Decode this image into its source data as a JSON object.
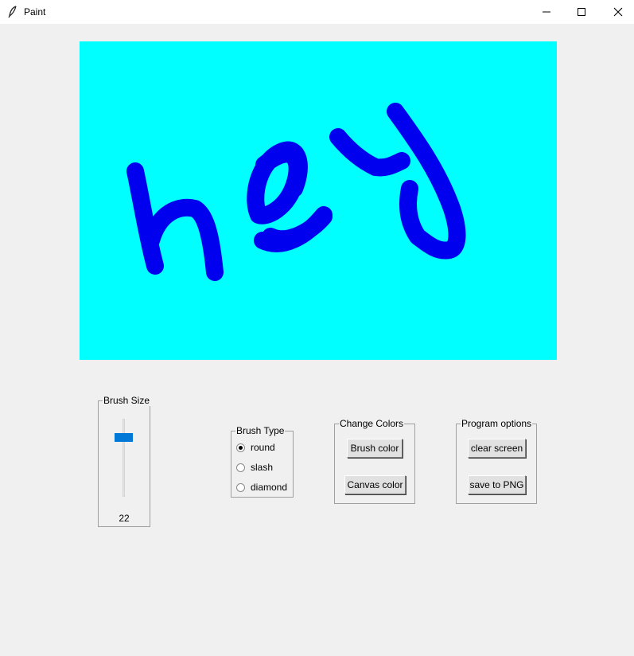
{
  "window": {
    "title": "Paint",
    "icon": "feather-icon",
    "controls": [
      "minimize-icon",
      "maximize-icon",
      "close-icon"
    ]
  },
  "canvas": {
    "background_color": "#00ffff",
    "stroke_color": "#0000ee",
    "drawn_text": "hey"
  },
  "brush_size": {
    "label": "Brush Size",
    "value": "22"
  },
  "brush_type": {
    "label": "Brush Type",
    "options": [
      "round",
      "slash",
      "diamond"
    ],
    "selected": "round"
  },
  "change_colors": {
    "label": "Change Colors",
    "brush_color_button": "Brush color",
    "canvas_color_button": "Canvas color"
  },
  "program_options": {
    "label": "Program options",
    "clear_button": "clear screen",
    "save_button": "save to PNG"
  },
  "colors": {
    "accent": "#0078d7",
    "window_bg": "#f0f0f0"
  }
}
